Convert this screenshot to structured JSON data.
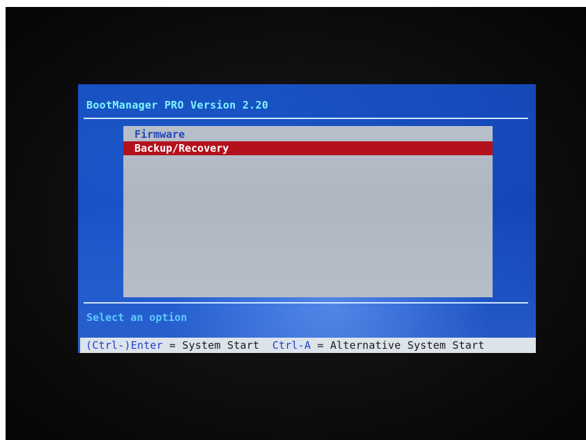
{
  "bootmanager": {
    "title": "BootManager PRO Version 2.20",
    "menu": {
      "items": [
        {
          "label": "Firmware"
        },
        {
          "label": "Backup/Recovery"
        }
      ],
      "selected_index": 1
    },
    "status_text": "Select an option",
    "hint_bar": {
      "key1": "(Ctrl-)Enter",
      "sep1": " = ",
      "action1": "System Start",
      "key2": "Ctrl-A",
      "sep2": " = ",
      "action2": "Alternative System Start"
    }
  },
  "colors": {
    "background_frame": "#0b0b0b",
    "screen_blue": "#1d5fd0",
    "title_cyan": "#7ff3ff",
    "menu_gray": "#b7bfca",
    "selection_red": "#b3121d",
    "status_cyan": "#5ec9ff",
    "hint_bar_bg": "#dde3ea",
    "hint_key_blue": "#1b3fcf"
  }
}
